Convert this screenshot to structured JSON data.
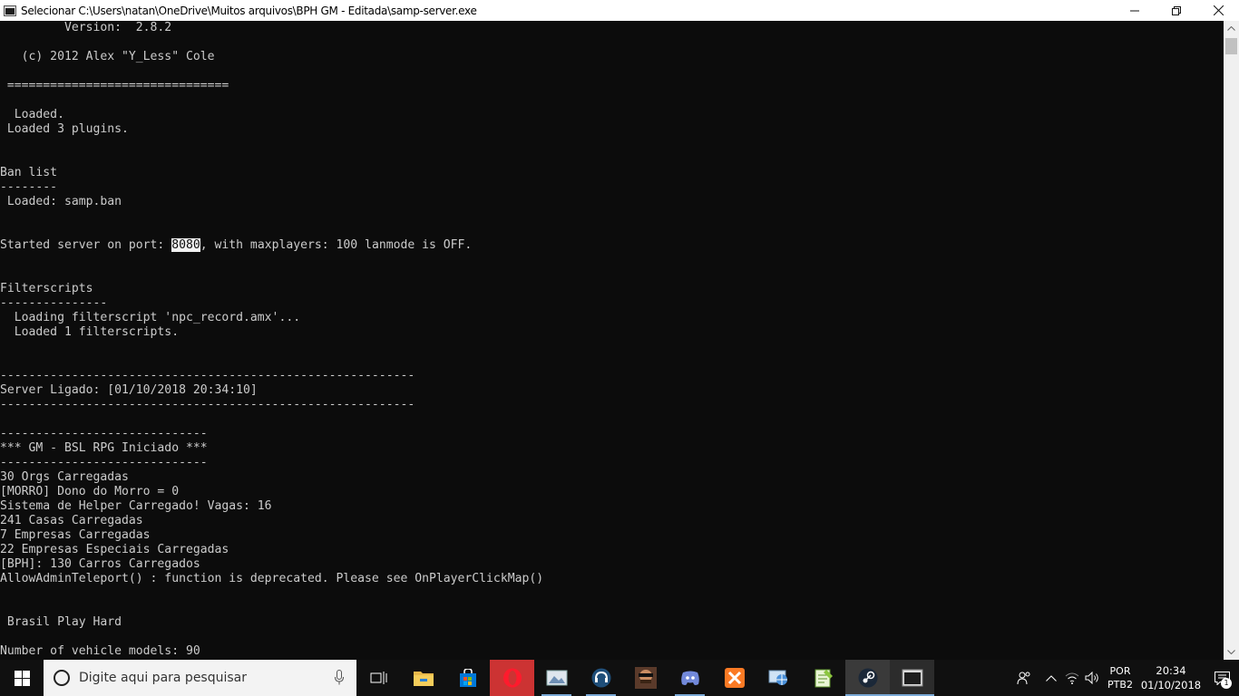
{
  "window": {
    "title": "Selecionar C:\\Users\\natan\\OneDrive\\Muitos arquivos\\BPH GM - Editada\\samp-server.exe",
    "controls": {
      "minimize": "—",
      "restore": "❐",
      "close": "✕"
    }
  },
  "console": {
    "lines": [
      "         Version:  2.8.2",
      "",
      "   (c) 2012 Alex \"Y_Less\" Cole",
      "",
      " ===============================",
      "",
      "  Loaded.",
      " Loaded 3 plugins.",
      "",
      "",
      "Ban list",
      "--------",
      " Loaded: samp.ban",
      "",
      "",
      "Started server on port: 8080, with maxplayers: 100 lanmode is OFF.",
      "",
      "",
      "Filterscripts",
      "---------------",
      "  Loading filterscript 'npc_record.amx'...",
      "  Loaded 1 filterscripts.",
      "",
      "",
      "----------------------------------------------------------",
      "Server Ligado: [01/10/2018 20:34:10]",
      "----------------------------------------------------------",
      "",
      "-----------------------------",
      "*** GM - BSL RPG Iniciado ***",
      "-----------------------------",
      "30 Orgs Carregadas",
      "[MORRO] Dono do Morro = 0",
      "Sistema de Helper Carregado! Vagas: 16",
      "241 Casas Carregadas",
      "7 Empresas Carregadas",
      "22 Empresas Especiais Carregadas",
      "[BPH]: 130 Carros Carregados",
      "AllowAdminTeleport() : function is deprecated. Please see OnPlayerClickMap()",
      "",
      "",
      " Brasil Play Hard",
      "",
      "Number of vehicle models: 90"
    ],
    "selected_text": "8080",
    "selected_line_index": 15,
    "text_color": "#cccccc",
    "background_color": "#0c0c0c"
  },
  "taskbar": {
    "search_placeholder": "Digite aqui para pesquisar",
    "apps": [
      {
        "name": "task-view-icon"
      },
      {
        "name": "file-explorer-icon"
      },
      {
        "name": "microsoft-store-icon"
      },
      {
        "name": "opera-icon"
      },
      {
        "name": "photos-icon"
      },
      {
        "name": "teamspeak-icon"
      },
      {
        "name": "game-avatar-icon"
      },
      {
        "name": "discord-icon"
      },
      {
        "name": "xampp-icon"
      },
      {
        "name": "network-tool-icon"
      },
      {
        "name": "notepad-plus-icon"
      },
      {
        "name": "steam-icon"
      },
      {
        "name": "console-app-icon"
      }
    ],
    "language": {
      "lang": "POR",
      "layout": "PTB2"
    },
    "clock": {
      "time": "20:34",
      "date": "01/10/2018"
    },
    "notification_count": "1"
  }
}
